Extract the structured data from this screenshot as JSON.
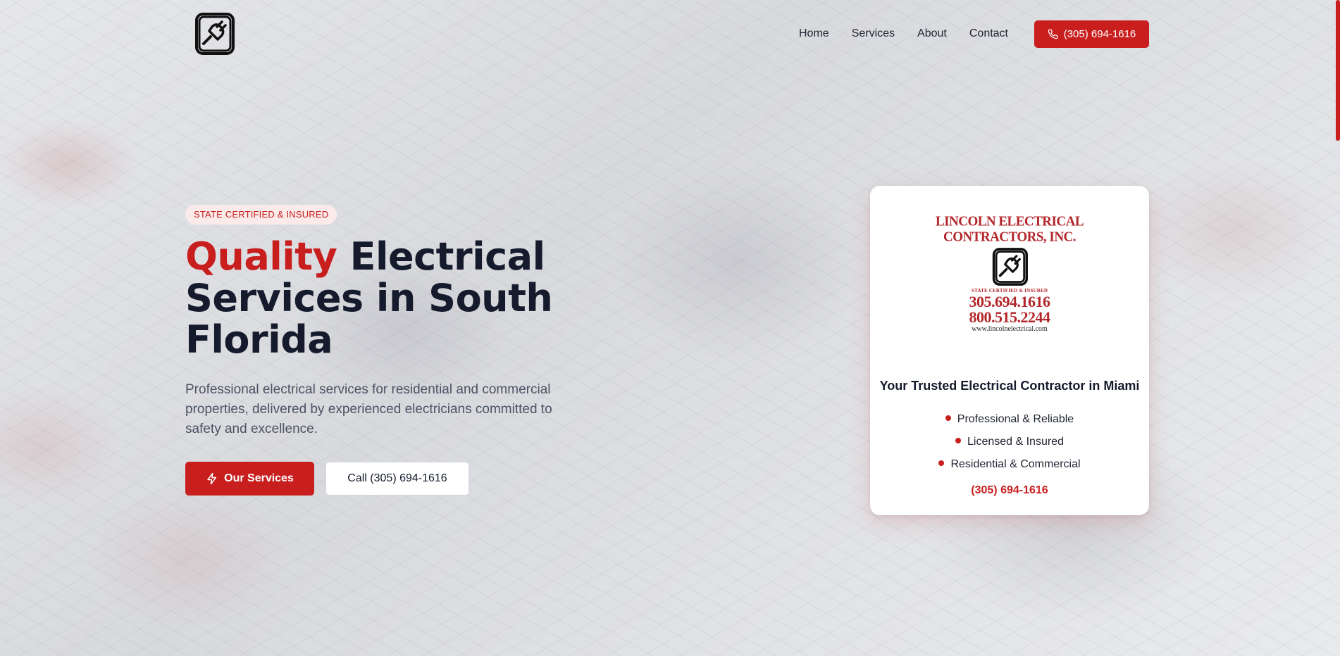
{
  "header": {
    "logo_icon": "plug-icon",
    "nav": [
      {
        "label": "Home"
      },
      {
        "label": "Services"
      },
      {
        "label": "About"
      },
      {
        "label": "Contact"
      }
    ],
    "phone_button": {
      "label": "(305) 694-1616",
      "icon": "phone-icon"
    }
  },
  "hero": {
    "badge": "STATE CERTIFIED & INSURED",
    "title_accent": "Quality",
    "title_rest": " Electrical Services in South Florida",
    "description": "Professional electrical services for residential and commercial properties, delivered by experienced electricians committed to safety and excellence.",
    "primary_button": {
      "label": "Our Services",
      "icon": "lightning-icon"
    },
    "secondary_button": {
      "label": "Call (305) 694-1616"
    }
  },
  "card": {
    "logo": {
      "name_line1": "LINCOLN ELECTRICAL",
      "name_line2": "CONTRACTORS, INC.",
      "cert": "STATE CERTIFIED & INSURED",
      "phone1": "305.694.1616",
      "phone2": "800.515.2244",
      "website": "www.lincolnelectrical.com"
    },
    "title": "Your Trusted Electrical Contractor in Miami",
    "features": [
      {
        "label": "Professional & Reliable"
      },
      {
        "label": "Licensed & Insured"
      },
      {
        "label": "Residential & Commercial"
      }
    ],
    "phone": "(305) 694-1616"
  },
  "colors": {
    "accent": "#c81e1e",
    "heading": "#151b2c",
    "body_text": "#4b5363"
  }
}
